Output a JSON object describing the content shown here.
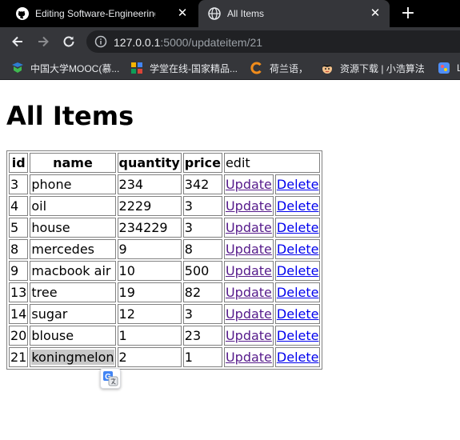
{
  "browser": {
    "tabs": [
      {
        "title": "Editing Software-Engineering-Cru",
        "icon": "github-icon",
        "active": false
      },
      {
        "title": "All Items",
        "icon": "globe-icon",
        "active": true
      }
    ],
    "url_host": "127.0.0.1",
    "url_path": ":5000/updateitem/21",
    "bookmarks": [
      {
        "label": "中国大学MOOC(慕...",
        "icon": "mooc-icon"
      },
      {
        "label": "学堂在线-国家精品...",
        "icon": "xuetang-icon"
      },
      {
        "label": "荷兰语，",
        "icon": "c-logo-icon"
      },
      {
        "label": "资源下载 | 小浩算法",
        "icon": "avatar-icon"
      },
      {
        "label": "L",
        "icon": "puzzle-icon"
      }
    ]
  },
  "page": {
    "title": "All Items",
    "table": {
      "headers": [
        "id",
        "name",
        "quantity",
        "price",
        "edit"
      ],
      "update_label": "Update",
      "delete_label": "Delete",
      "rows": [
        {
          "id": "3",
          "name": "phone",
          "quantity": "234",
          "price": "342"
        },
        {
          "id": "4",
          "name": "oil",
          "quantity": "2229",
          "price": "3"
        },
        {
          "id": "5",
          "name": "house",
          "quantity": "234229",
          "price": "3"
        },
        {
          "id": "8",
          "name": "mercedes",
          "quantity": "9",
          "price": "8"
        },
        {
          "id": "9",
          "name": "macbook air",
          "quantity": "10",
          "price": "500"
        },
        {
          "id": "13",
          "name": "tree",
          "quantity": "19",
          "price": "82"
        },
        {
          "id": "14",
          "name": "sugar",
          "quantity": "12",
          "price": "3"
        },
        {
          "id": "20",
          "name": "blouse",
          "quantity": "1",
          "price": "23"
        },
        {
          "id": "21",
          "name": "koningmelon",
          "quantity": "2",
          "price": "1"
        }
      ]
    }
  },
  "colors": {
    "link": "#0000ee",
    "visited_link": "#551a8b",
    "chrome_dark": "#35363a"
  }
}
